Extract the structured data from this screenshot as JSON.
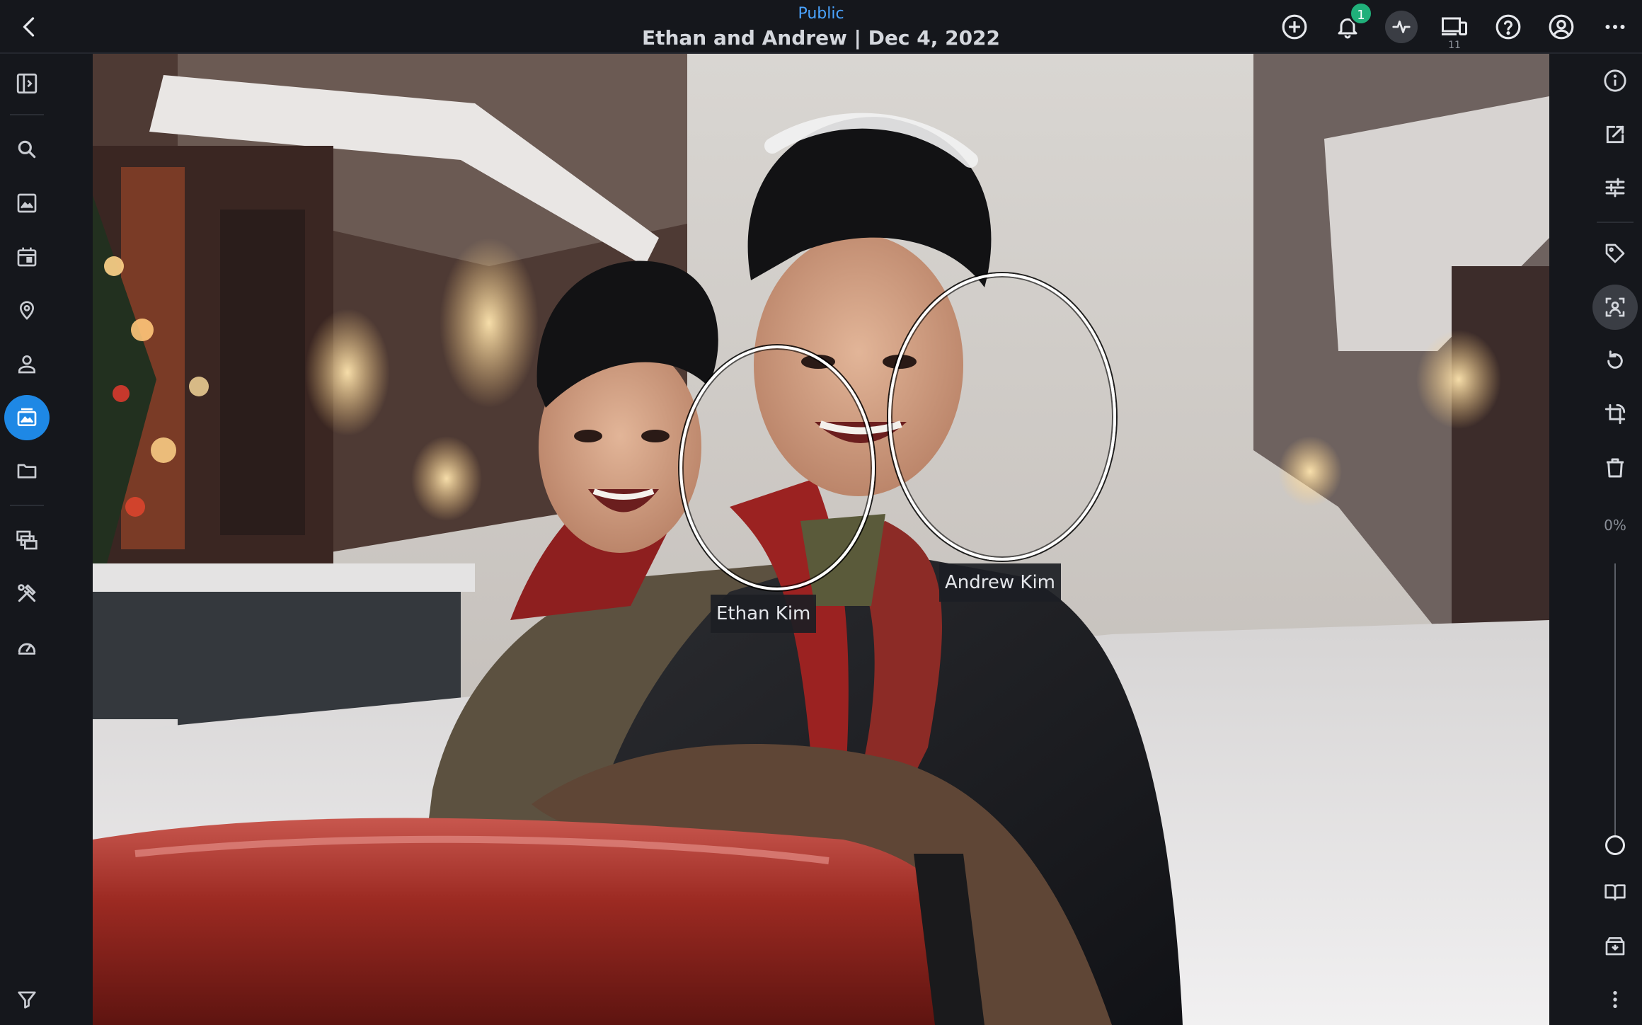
{
  "header": {
    "visibility": "Public",
    "title": "Ethan and Andrew | Dec 4, 2022",
    "notification_count": "1",
    "device_count": "11"
  },
  "left_rail": {
    "icons": [
      "sidebar-toggle-icon",
      "search-icon",
      "photos-icon",
      "calendar-icon",
      "places-icon",
      "people-icon",
      "albums-icon",
      "folders-icon",
      "library-icon",
      "tools-icon",
      "dashboard-icon",
      "filter-icon"
    ],
    "active": "albums-icon"
  },
  "faces": [
    {
      "name": "Ethan Kim"
    },
    {
      "name": "Andrew Kim"
    }
  ],
  "right_rail": {
    "zoom_label": "0%",
    "zoom_level": 0
  },
  "colors": {
    "accent": "#1e88e5",
    "public": "#4aa3ff",
    "badge": "#20b07a",
    "background": "#15171c"
  }
}
